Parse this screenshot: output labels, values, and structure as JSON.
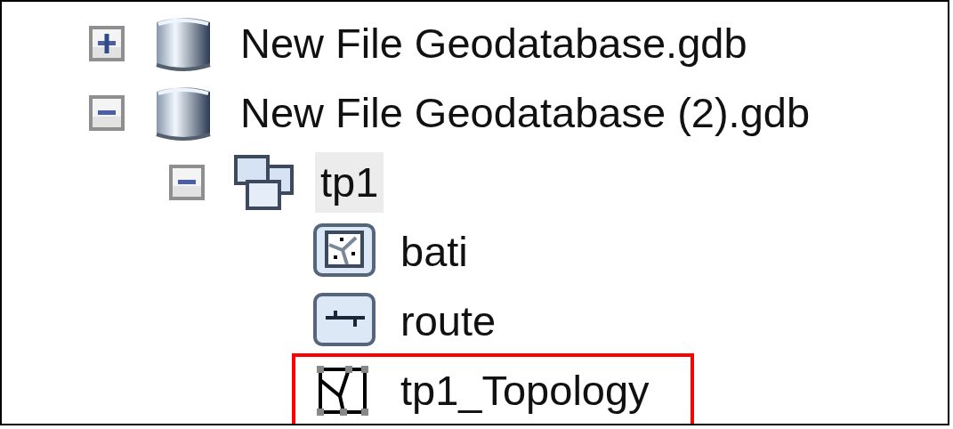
{
  "tree": {
    "items": [
      {
        "label": "New File Geodatabase.gdb",
        "kind": "geodatabase",
        "expanded": false,
        "selected": false
      },
      {
        "label": "New File Geodatabase (2).gdb",
        "kind": "geodatabase",
        "expanded": true,
        "selected": false,
        "children": [
          {
            "label": "tp1",
            "kind": "feature-dataset",
            "expanded": true,
            "selected": true,
            "children": [
              {
                "label": "bati",
                "kind": "polygon-class",
                "selected": false
              },
              {
                "label": "route",
                "kind": "line-class",
                "selected": false
              },
              {
                "label": "tp1_Topology",
                "kind": "topology",
                "selected": false,
                "highlighted": true
              }
            ]
          }
        ]
      }
    ]
  }
}
